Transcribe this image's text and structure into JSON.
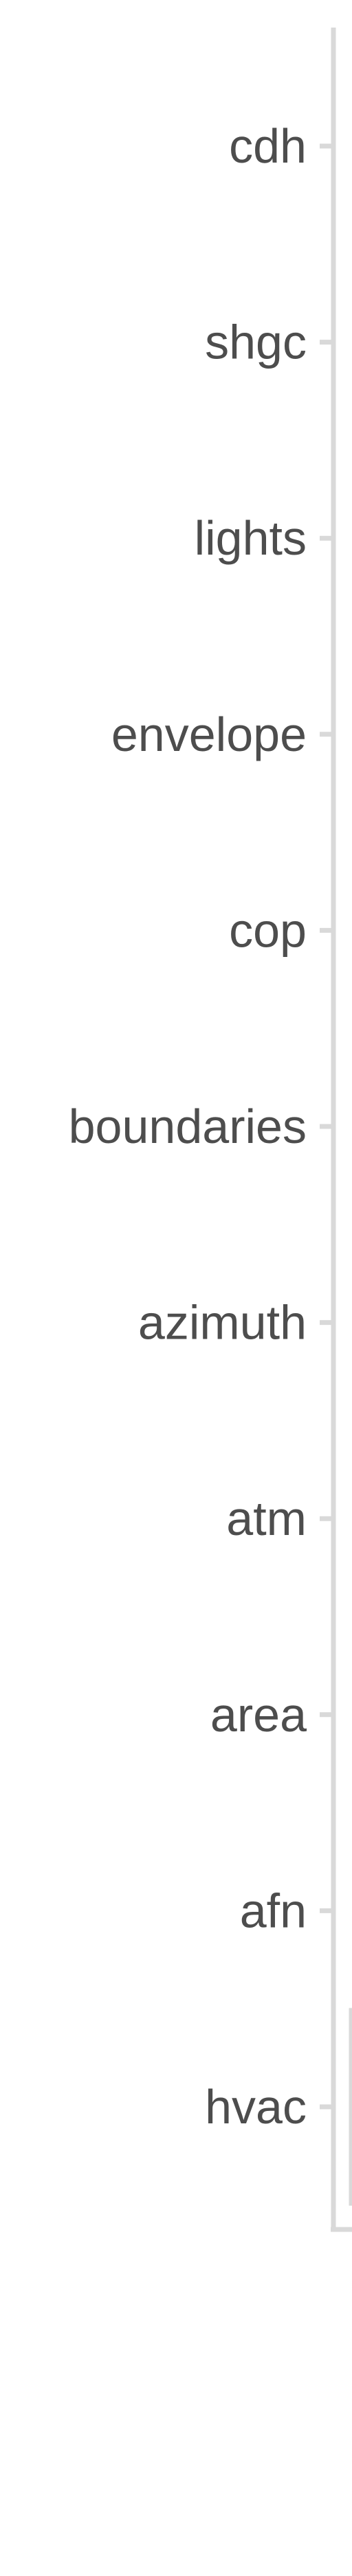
{
  "chart_data": {
    "type": "bar",
    "orientation": "horizontal",
    "categories": [
      "cdh",
      "shgc",
      "lights",
      "envelope",
      "cop",
      "boundaries",
      "azimuth",
      "atm",
      "area",
      "afn",
      "hvac"
    ],
    "values": [
      null,
      null,
      null,
      null,
      null,
      null,
      null,
      null,
      null,
      null,
      null
    ],
    "title": "",
    "xlabel": "",
    "ylabel": "",
    "grid": false,
    "colors": {
      "axis": "#d9d9d9",
      "tick": "#d9d9d9",
      "label": "#4d4d4d",
      "bar_outline": "#d9d9d9"
    }
  }
}
